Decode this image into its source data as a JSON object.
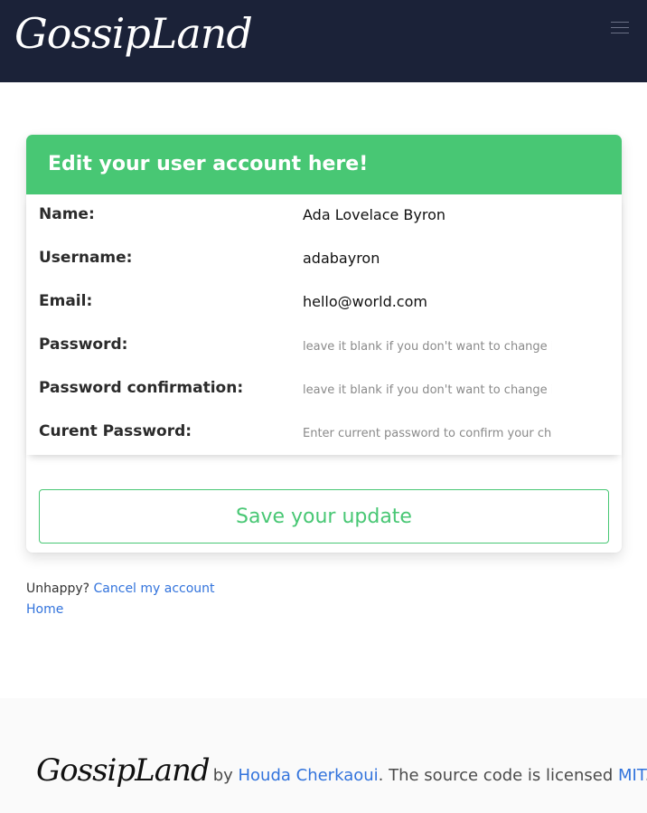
{
  "navbar": {
    "brand": "GossipLand",
    "menu_icon": "hamburger-icon",
    "background": "#1b2238"
  },
  "card": {
    "title": "Edit your user account here!",
    "header_color": "#48c774",
    "fields": [
      {
        "label": "Name:",
        "value": "Ada Lovelace Byron",
        "placeholder": ""
      },
      {
        "label": "Username:",
        "value": "adabayron",
        "placeholder": ""
      },
      {
        "label": "Email:",
        "value": "hello@world.com",
        "placeholder": ""
      },
      {
        "label": "Password:",
        "value": "",
        "placeholder": "leave it blank if you don't want to change it"
      },
      {
        "label": "Password confirmation:",
        "value": "",
        "placeholder": "leave it blank if you don't want to change it"
      },
      {
        "label": "Curent Password:",
        "value": "",
        "placeholder": "Enter current password to confirm your changes"
      }
    ],
    "save_label": "Save your update"
  },
  "links": {
    "unhappy_text": "Unhappy?",
    "cancel_label": "Cancel my account",
    "home_label": "Home"
  },
  "footer": {
    "logo": "GossipLand",
    "by_text": "by",
    "author": "Houda Cherkaoui",
    "license_text": ". The source code is licensed",
    "license_link": "MIT",
    "end_text": "."
  },
  "colors": {
    "link": "#3273dc",
    "accent": "#48c774"
  }
}
